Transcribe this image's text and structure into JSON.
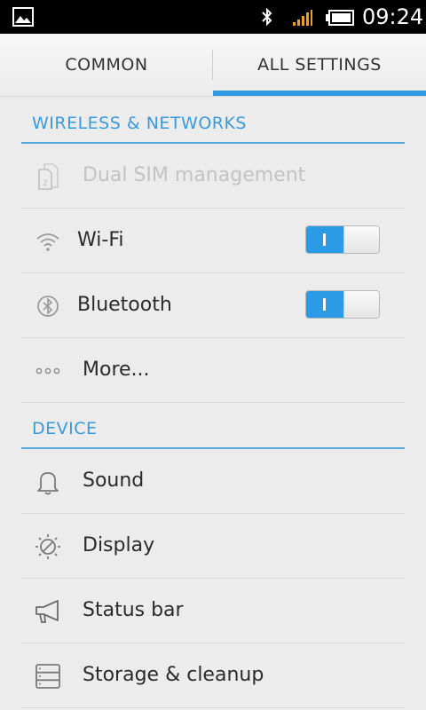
{
  "status_bar": {
    "time": "09:24",
    "icons": [
      "picture-icon",
      "bluetooth-icon",
      "signal-icon",
      "battery-icon"
    ],
    "signal_color": "#f0a020"
  },
  "tabs": [
    {
      "label": "COMMON",
      "selected": false
    },
    {
      "label": "ALL SETTINGS",
      "selected": true
    }
  ],
  "accent_color": "#2e9ae3",
  "sections": {
    "wireless": {
      "title": "WIRELESS & NETWORKS",
      "items": [
        {
          "label": "Dual SIM management",
          "icon": "dual-sim-icon",
          "enabled": false
        },
        {
          "label": "Wi-Fi",
          "icon": "wifi-icon",
          "toggle": "on"
        },
        {
          "label": "Bluetooth",
          "icon": "bluetooth-icon",
          "toggle": "on"
        },
        {
          "label": "More...",
          "icon": "more-icon"
        }
      ]
    },
    "device": {
      "title": "DEVICE",
      "items": [
        {
          "label": "Sound",
          "icon": "bell-icon"
        },
        {
          "label": "Display",
          "icon": "brightness-icon"
        },
        {
          "label": "Status bar",
          "icon": "megaphone-icon"
        },
        {
          "label": "Storage & cleanup",
          "icon": "storage-icon"
        }
      ]
    }
  }
}
